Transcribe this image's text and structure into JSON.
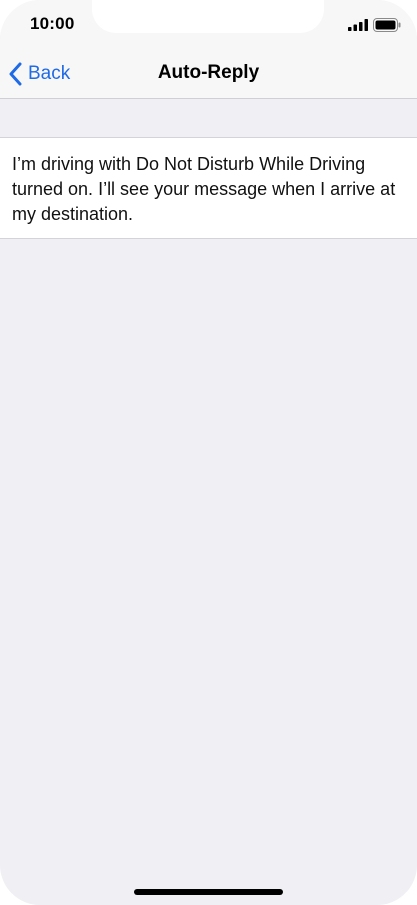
{
  "status_bar": {
    "time": "10:00",
    "signal_icon": "cellular-signal-icon",
    "battery_icon": "battery-icon"
  },
  "nav": {
    "back_label": "Back",
    "back_icon": "chevron-left-icon",
    "title": "Auto-Reply"
  },
  "auto_reply": {
    "message": "I’m driving with Do Not Disturb While Driving turned on. I’ll see your message when I arrive at my destination."
  },
  "colors": {
    "accent": "#1f6ae6",
    "background": "#efeff4",
    "header": "#f7f7f7"
  }
}
